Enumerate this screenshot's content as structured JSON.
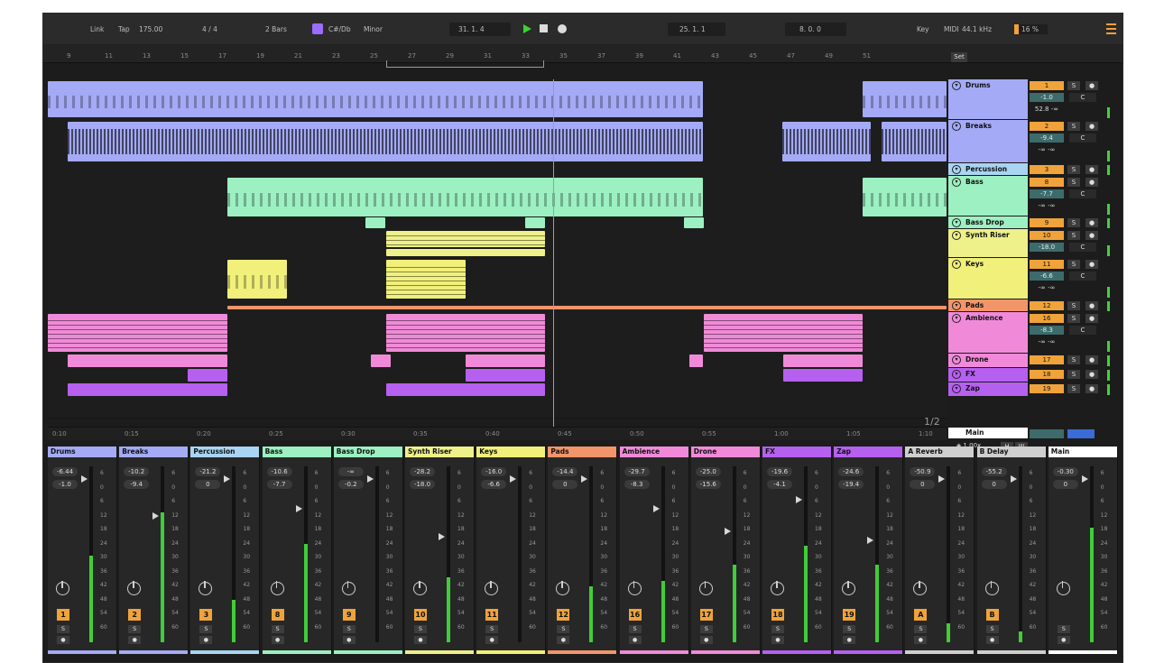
{
  "transport": {
    "link": "Link",
    "tap": "Tap",
    "tempo": "175.00",
    "sig": "4 / 4",
    "bars": "2 Bars",
    "root": "C#/Db",
    "scale": "Minor",
    "position": "31.  1.  4",
    "loop_start": "25.  1.  1",
    "loop_len": "8.  0.  0",
    "key": "Key",
    "midi": "MIDI",
    "sample_rate": "44.1 kHz",
    "cpu": "16 %",
    "play_color": "#38d62f"
  },
  "ruler": [
    "9",
    "11",
    "13",
    "15",
    "17",
    "19",
    "21",
    "23",
    "25",
    "27",
    "29",
    "31",
    "33",
    "35",
    "37",
    "39",
    "41",
    "43",
    "45",
    "47",
    "49",
    "51"
  ],
  "timebar": [
    "0:10",
    "0:15",
    "0:20",
    "0:25",
    "0:30",
    "0:35",
    "0:40",
    "0:45",
    "0:50",
    "0:55",
    "1:00",
    "1:05",
    "1:10"
  ],
  "set_label": "Set",
  "page_indicator": "1/2",
  "tracks": [
    {
      "name": "Drums",
      "num": "1",
      "vol": "-1.0",
      "pan": "C",
      "color": "#a4aaf5",
      "extra": "52.8  -∞"
    },
    {
      "name": "Breaks",
      "num": "2",
      "vol": "-9.4",
      "pan": "C",
      "color": "#a4aaf5",
      "extra": "-∞  -∞"
    },
    {
      "name": "Percussion",
      "num": "3",
      "vol": "",
      "pan": "",
      "color": "#a9d4f2"
    },
    {
      "name": "Bass",
      "num": "8",
      "vol": "-7.7",
      "pan": "C",
      "color": "#9cf0c1",
      "extra": "-∞  -∞"
    },
    {
      "name": "Bass Drop",
      "num": "9",
      "vol": "",
      "pan": "",
      "color": "#9cf0c1"
    },
    {
      "name": "Synth Riser",
      "num": "10",
      "vol": "-18.0",
      "pan": "C",
      "color": "#eef08a"
    },
    {
      "name": "Keys",
      "num": "11",
      "vol": "-6.6",
      "pan": "C",
      "color": "#f1f07a",
      "extra": "-∞  -∞"
    },
    {
      "name": "Pads",
      "num": "12",
      "vol": "",
      "pan": "",
      "color": "#f2956a"
    },
    {
      "name": "Ambience",
      "num": "16",
      "vol": "-8.3",
      "pan": "C",
      "color": "#f08ad8",
      "extra": "-∞  -∞"
    },
    {
      "name": "Drone",
      "num": "17",
      "vol": "",
      "pan": "",
      "color": "#f08ad8"
    },
    {
      "name": "FX",
      "num": "18",
      "vol": "",
      "pan": "",
      "color": "#b660f0"
    },
    {
      "name": "Zap",
      "num": "19",
      "vol": "",
      "pan": "",
      "color": "#b660f0"
    }
  ],
  "main_track": {
    "name": "Main",
    "zoom": "1.00x",
    "h": "H",
    "w": "W"
  },
  "mixer": [
    {
      "name": "Drums",
      "v1": "-6.44",
      "v2": "-1.0",
      "num": "1",
      "color": "#a4aaf5",
      "level": 0.49,
      "fader": 0.05
    },
    {
      "name": "Breaks",
      "v1": "-10.2",
      "v2": "-9.4",
      "num": "2",
      "color": "#a4aaf5",
      "level": 0.74,
      "fader": 0.26
    },
    {
      "name": "Percussion",
      "v1": "-21.2",
      "v2": "0",
      "num": "3",
      "color": "#a9d4f2",
      "level": 0.24,
      "fader": 0.05
    },
    {
      "name": "Bass",
      "v1": "-10.6",
      "v2": "-7.7",
      "num": "8",
      "color": "#9cf0c1",
      "level": 0.56,
      "fader": 0.22
    },
    {
      "name": "Bass Drop",
      "v1": "-∞",
      "v2": "-0.2",
      "num": "9",
      "color": "#9cf0c1",
      "level": 0.0,
      "fader": 0.05
    },
    {
      "name": "Synth Riser",
      "v1": "-28.2",
      "v2": "-18.0",
      "num": "10",
      "color": "#eef08a",
      "level": 0.37,
      "fader": 0.38
    },
    {
      "name": "Keys",
      "v1": "-16.0",
      "v2": "-6.6",
      "num": "11",
      "color": "#f1f07a",
      "level": 0.0,
      "fader": 0.05
    },
    {
      "name": "Pads",
      "v1": "-14.4",
      "v2": "0",
      "num": "12",
      "color": "#f2956a",
      "level": 0.32,
      "fader": 0.05
    },
    {
      "name": "Ambience",
      "v1": "-29.7",
      "v2": "-8.3",
      "num": "16",
      "color": "#f08ad8",
      "level": 0.35,
      "fader": 0.22
    },
    {
      "name": "Drone",
      "v1": "-25.0",
      "v2": "-15.6",
      "num": "17",
      "color": "#f08ad8",
      "level": 0.44,
      "fader": 0.35
    },
    {
      "name": "FX",
      "v1": "-19.6",
      "v2": "-4.1",
      "num": "18",
      "color": "#b660f0",
      "level": 0.55,
      "fader": 0.17
    },
    {
      "name": "Zap",
      "v1": "-24.6",
      "v2": "-19.4",
      "num": "19",
      "color": "#b660f0",
      "level": 0.44,
      "fader": 0.4
    },
    {
      "name": "A Reverb",
      "v1": "-50.9",
      "v2": "0",
      "num": "A",
      "color": "#cfcfcf",
      "level": 0.11,
      "fader": 0.05
    },
    {
      "name": "B Delay",
      "v1": "-55.2",
      "v2": "0",
      "num": "B",
      "color": "#cfcfcf",
      "level": 0.06,
      "fader": 0.05
    },
    {
      "name": "Main",
      "v1": "-0.30",
      "v2": "0",
      "num": "",
      "color": "#ffffff",
      "level": 0.65,
      "fader": 0.05
    }
  ],
  "meter_scale": [
    "6",
    "0",
    "6",
    "12",
    "18",
    "24",
    "30",
    "36",
    "42",
    "48",
    "54",
    "60"
  ]
}
